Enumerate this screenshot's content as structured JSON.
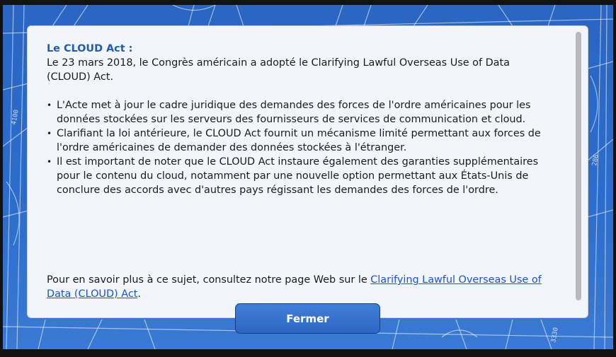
{
  "dialog": {
    "title": "Le CLOUD Act :",
    "intro": "Le 23 mars 2018, le Congrès américain a adopté le Clarifying Lawful Overseas Use of Data (CLOUD) Act.",
    "bullets": [
      "L'Acte met à jour le cadre juridique des demandes des forces de l'ordre américaines pour les données stockées sur les serveurs des fournisseurs de services de communication et cloud.",
      "Clarifiant la loi antérieure, le CLOUD Act fournit un mécanisme limité permettant aux forces de l'ordre américaines de demander des données stockées à l'étranger.",
      "Il est important de noter que le CLOUD Act instaure également des garanties supplémentaires pour le contenu du cloud, notamment par une nouvelle option permettant aux États-Unis de conclure des accords avec d'autres pays régissant les demandes des forces de l'ordre."
    ],
    "footer_text": "Pour en savoir plus à ce sujet, consultez notre page Web sur le ",
    "footer_link": "Clarifying Lawful Overseas Use of Data (CLOUD) Act",
    "footer_end": "."
  },
  "close_button": {
    "label": "Fermer"
  },
  "background": {
    "labels": [
      "4100",
      "286",
      "3330",
      "2280"
    ]
  },
  "colors": {
    "title": "#1f5bb8",
    "link": "#1a52d6",
    "button": "#2d66c3",
    "backdrop": "#2b6ccc"
  }
}
